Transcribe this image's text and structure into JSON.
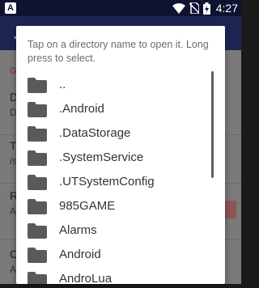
{
  "status_bar": {
    "left_icon": "A",
    "time": "4:27",
    "icons": [
      "wifi-icon",
      "no-sim-icon",
      "battery-charging-icon"
    ]
  },
  "background_app": {
    "category_letter": "G",
    "rows": [
      {
        "title": "D",
        "sub": "D"
      },
      {
        "title": "T",
        "sub": "/s"
      },
      {
        "title": "R",
        "sub": "A"
      },
      {
        "title": "C",
        "sub": "A"
      }
    ]
  },
  "dialog": {
    "message": "Tap on a directory name to open it. Long press to select.",
    "directories": [
      "..",
      ".Android",
      ".DataStorage",
      ".SystemService",
      ".UTSystemConfig",
      "985GAME",
      "Alarms",
      "Android",
      "AndroLua"
    ]
  },
  "colors": {
    "status_bar": "#0d1330",
    "app_toolbar": "#1d2652",
    "folder_icon": "#5a5a5a",
    "dialog_bg": "#ffffff"
  }
}
